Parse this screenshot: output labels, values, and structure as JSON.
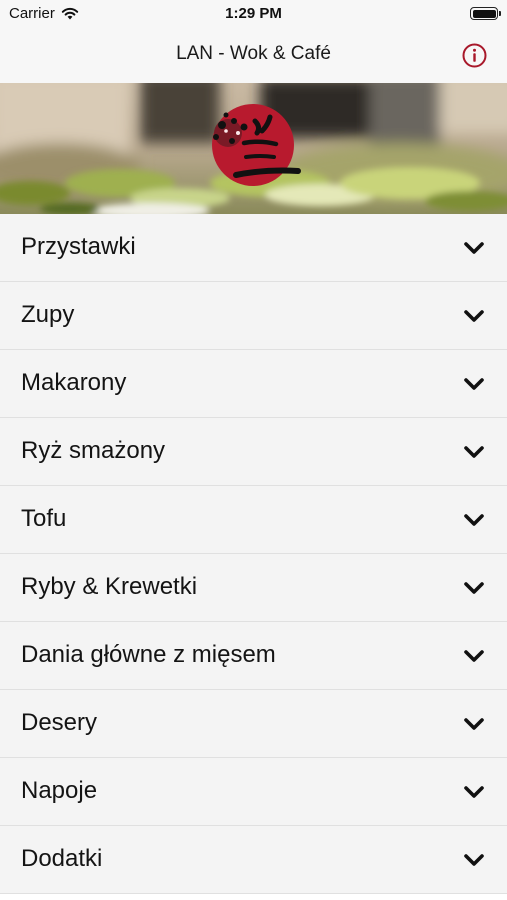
{
  "status": {
    "carrier": "Carrier",
    "time": "1:29 PM"
  },
  "nav": {
    "title": "LAN - Wok & Café",
    "info_icon": "info-circle-icon"
  },
  "colors": {
    "accent": "#a8182a",
    "logo_red": "#b81a2e"
  },
  "menu": {
    "items": [
      {
        "label": "Przystawki"
      },
      {
        "label": "Zupy"
      },
      {
        "label": "Makarony"
      },
      {
        "label": "Ryż smażony"
      },
      {
        "label": "Tofu"
      },
      {
        "label": "Ryby & Krewetki"
      },
      {
        "label": "Dania główne z mięsem"
      },
      {
        "label": "Desery"
      },
      {
        "label": "Napoje"
      },
      {
        "label": "Dodatki"
      }
    ]
  }
}
